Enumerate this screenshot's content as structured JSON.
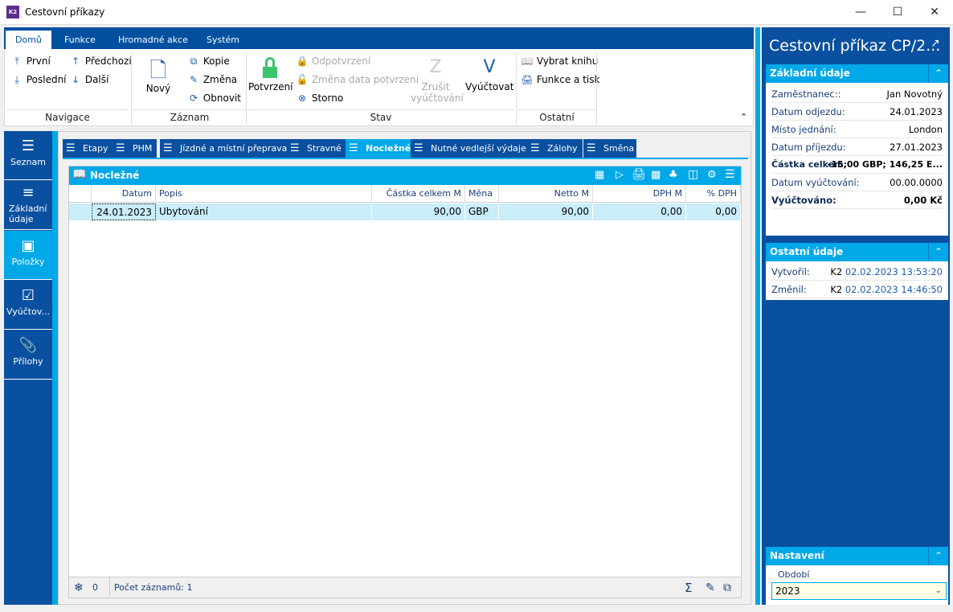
{
  "window": {
    "title": "Cestovní příkazy",
    "logo": "K2",
    "minimize": "minimize-icon",
    "maximize": "maximize-icon",
    "close": "close-icon"
  },
  "ribbon": {
    "tabs": [
      {
        "label": "Domů",
        "active": true
      },
      {
        "label": "Funkce"
      },
      {
        "label": "Hromadné akce"
      },
      {
        "label": "Systém"
      }
    ],
    "groups": {
      "navigace": "Navigace",
      "zaznam": "Záznam",
      "stav": "Stav",
      "ostatni": "Ostatní"
    },
    "buttons": {
      "prvni": "První",
      "predchozi": "Předchozí",
      "posledni": "Poslední",
      "dalsi": "Další",
      "novy": "Nový",
      "kopie": "Kopie",
      "zmena": "Změna",
      "obnovit": "Obnovit",
      "potvrzeni": "Potvrzení",
      "odpotvrzeni": "Odpotvrzení",
      "zmena_data": "Změna data potvrzení",
      "storno": "Storno",
      "zrusit1": "Zrušit",
      "zrusit2": "vyúčtování",
      "vyuctovat": "Vyúčtovat",
      "vybrat_knihu": "Vybrat knihu",
      "funkce_tisk": "Funkce a tisk"
    }
  },
  "leftnav": [
    {
      "label": "Seznam"
    },
    {
      "label": "Základní údaje"
    },
    {
      "label": "Položky",
      "active": true
    },
    {
      "label": "Vyúčtov..."
    },
    {
      "label": "Přílohy"
    }
  ],
  "tabs": [
    {
      "label": "Etapy"
    },
    {
      "label": "PHM"
    },
    {
      "label": "Jízdné a místní přeprava"
    },
    {
      "label": "Stravné"
    },
    {
      "label": "Nocležné",
      "active": true
    },
    {
      "label": "Nutné vedlejší výdaje"
    },
    {
      "label": "Zálohy"
    },
    {
      "label": "Směna"
    }
  ],
  "grid": {
    "title": "Nocležné",
    "columns": [
      "Datum",
      "Popis",
      "Částka celkem M",
      "Měna",
      "Netto M",
      "DPH M",
      "% DPH"
    ],
    "rows": [
      [
        "24.01.2023",
        "Ubytování",
        "90,00",
        "GBP",
        "90,00",
        "0,00",
        "0,00"
      ]
    ],
    "footer": {
      "filter_count": "0",
      "records": "Počet záznamů: 1"
    }
  },
  "right": {
    "title": "Cestovní příkaz CP/2...",
    "zakladni": {
      "header": "Základní údaje",
      "fields": [
        {
          "label": "Zaměstnanec::",
          "value": "Jan Novotný"
        },
        {
          "label": "Datum odjezdu:",
          "value": "24.01.2023"
        },
        {
          "label": "Místo jednání:",
          "value": "London"
        },
        {
          "label": "Datum příjezdu:",
          "value": "27.01.2023"
        },
        {
          "label": "Částka celkem:",
          "value": "-15,00 GBP; 146,25 E...",
          "bold": true
        },
        {
          "label": "Datum vyúčtování:",
          "value": "00.00.0000"
        },
        {
          "label": "Vyúčtováno:",
          "value": "0,00 Kč",
          "bold": true
        }
      ]
    },
    "ostatni": {
      "header": "Ostatní údaje",
      "fields": [
        {
          "label": "Vytvořil:",
          "user": "K2",
          "value": "02.02.2023 13:53:20"
        },
        {
          "label": "Změnil:",
          "user": "K2",
          "value": "02.02.2023 14:46:50"
        }
      ]
    },
    "nastaveni": {
      "header": "Nastavení",
      "obdobi_label": "Období",
      "obdobi_value": "2023"
    }
  },
  "colors": {
    "dark_blue": "#0a50a0",
    "accent": "#00a8e8",
    "row_selected": "#c9eefa",
    "confirm_green": "#3cc36e"
  }
}
